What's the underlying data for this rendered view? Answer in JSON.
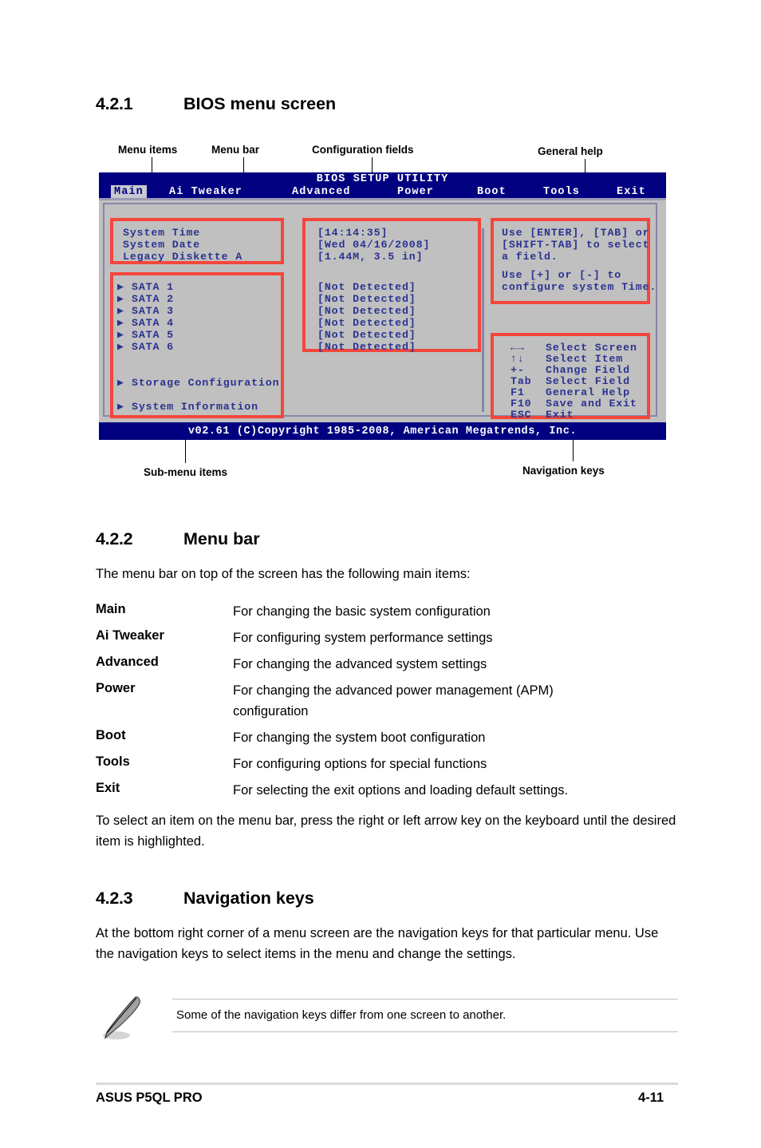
{
  "sections": {
    "s1": {
      "num": "4.2.1",
      "title": "BIOS menu screen"
    },
    "s2": {
      "num": "4.2.2",
      "title": "Menu bar"
    },
    "s3": {
      "num": "4.2.3",
      "title": "Navigation keys"
    }
  },
  "callouts": {
    "menu_items": "Menu items",
    "menu_bar": "Menu bar",
    "config_fields": "Configuration fields",
    "general_help": "General help",
    "sub_menu_items": "Sub-menu items",
    "navigation_keys": "Navigation keys"
  },
  "bios": {
    "title": "BIOS SETUP UTILITY",
    "menu_tabs": [
      {
        "label": "Main",
        "selected": true
      },
      {
        "label": "Ai Tweaker",
        "selected": false
      },
      {
        "label": "Advanced",
        "selected": false
      },
      {
        "label": "Power",
        "selected": false
      },
      {
        "label": "Boot",
        "selected": false
      },
      {
        "label": "Tools",
        "selected": false
      },
      {
        "label": "Exit",
        "selected": false
      }
    ],
    "menu_items_group1": [
      "System Time",
      "System Date",
      "Legacy Diskette A"
    ],
    "config_group1": [
      "[14:14:35]",
      "[Wed 04/16/2008]",
      "[1.44M, 3.5 in]"
    ],
    "sata_items": [
      "SATA 1",
      "SATA 2",
      "SATA 3",
      "SATA 4",
      "SATA 5",
      "SATA 6"
    ],
    "sata_values": [
      "[Not Detected]",
      "[Not Detected]",
      "[Not Detected]",
      "[Not Detected]",
      "[Not Detected]",
      "[Not Detected]"
    ],
    "submenu_items": [
      "Storage Configuration",
      "System Information"
    ],
    "help_text_1": "Use [ENTER], [TAB] or\n[SHIFT-TAB] to select\na field.",
    "help_text_2": "Use [+] or [-] to\nconfigure system Time.",
    "nav_keys": [
      {
        "key": "←→",
        "desc": "Select Screen"
      },
      {
        "key": "↑↓",
        "desc": "Select Item"
      },
      {
        "key": "+-",
        "desc": "Change Field"
      },
      {
        "key": "Tab",
        "desc": "Select Field"
      },
      {
        "key": "F1",
        "desc": "General Help"
      },
      {
        "key": "F10",
        "desc": "Save and Exit"
      },
      {
        "key": "ESC",
        "desc": "Exit"
      }
    ],
    "copyright": "v02.61 (C)Copyright 1985-2008, American Megatrends, Inc."
  },
  "menu_bar_section": {
    "intro": "The menu bar on top of the screen has the following main items:",
    "entries": [
      {
        "term": "Main",
        "def": "For changing the basic system configuration"
      },
      {
        "term": "Ai Tweaker",
        "def": "For configuring system performance settings"
      },
      {
        "term": "Advanced",
        "def": "For changing the advanced system settings"
      },
      {
        "term": "Power",
        "def": "For changing the advanced power management (APM) configuration"
      },
      {
        "term": "Boot",
        "def": "For changing the system boot configuration"
      },
      {
        "term": "Tools",
        "def": "For configuring options for special functions"
      },
      {
        "term": "Exit",
        "def": "For selecting the exit options and loading default settings."
      }
    ],
    "outro": "To select an item on the menu bar, press the right or left arrow key on the keyboard until the desired item is highlighted."
  },
  "nav_keys_section": {
    "paragraph": "At the bottom right corner of a menu screen are the navigation keys for that particular menu. Use the navigation keys to select items in the menu and change the settings.",
    "note": "Some of the navigation keys differ from one screen to another."
  },
  "footer": {
    "left": "ASUS P5QL PRO",
    "right": "4-11"
  },
  "colors": {
    "bios_blue": "#000080",
    "bios_gray": "#c0c0c0",
    "highlight_red": "#f4463c",
    "bios_text": "#2b3390"
  }
}
